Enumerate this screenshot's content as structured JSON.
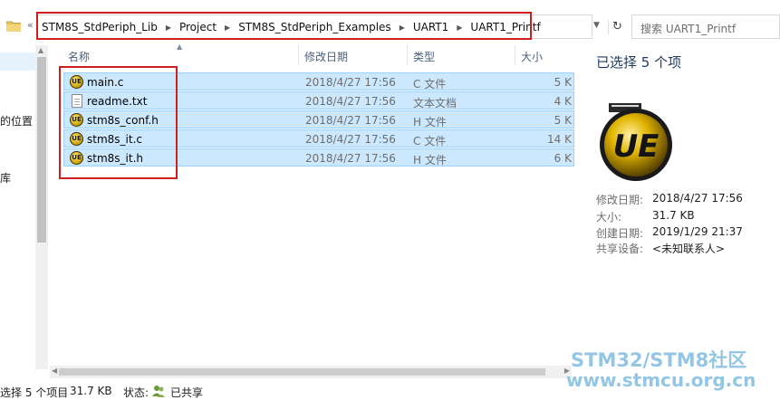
{
  "address": {
    "crumbs": [
      "STM8S_StdPeriph_Lib",
      "Project",
      "STM8S_StdPeriph_Examples",
      "UART1",
      "UART1_Printf"
    ],
    "search_placeholder": "搜索 UART1_Printf"
  },
  "nav": {
    "labels": [
      "的位置",
      "库"
    ]
  },
  "columns": {
    "name": "名称",
    "date": "修改日期",
    "type": "类型",
    "size": "大小"
  },
  "files": [
    {
      "name": "main.c",
      "date": "2018/4/27 17:56",
      "type": "C 文件",
      "size": "5 K",
      "icon": "ultraedit-icon"
    },
    {
      "name": "readme.txt",
      "date": "2018/4/27 17:56",
      "type": "文本文档",
      "size": "4 K",
      "icon": "text-file-icon"
    },
    {
      "name": "stm8s_conf.h",
      "date": "2018/4/27 17:56",
      "type": "H 文件",
      "size": "5 K",
      "icon": "ultraedit-icon"
    },
    {
      "name": "stm8s_it.c",
      "date": "2018/4/27 17:56",
      "type": "C 文件",
      "size": "14 K",
      "icon": "ultraedit-icon"
    },
    {
      "name": "stm8s_it.h",
      "date": "2018/4/27 17:56",
      "type": "H 文件",
      "size": "6 K",
      "icon": "ultraedit-icon"
    }
  ],
  "details": {
    "title": "已选择 5 个项",
    "icon_text": "UE",
    "modified_label": "修改日期:",
    "modified_value": "2018/4/27 17:56",
    "size_label": "大小:",
    "size_value": "31.7 KB",
    "created_label": "创建日期:",
    "created_value": "2019/1/29 21:37",
    "shared_label": "共享设备:",
    "shared_value": "<未知联系人>"
  },
  "status": {
    "selected": "选择 5 个项目",
    "size": "31.7 KB",
    "state_label": "状态:",
    "state_value": "已共享"
  },
  "watermark": {
    "line1": "STM32/STM8社区",
    "line2": "www.stmcu.org.cn"
  },
  "colors": {
    "selection": "#cce8ff",
    "highlight_box": "#d21d1d",
    "watermark": "#7fbde0"
  }
}
